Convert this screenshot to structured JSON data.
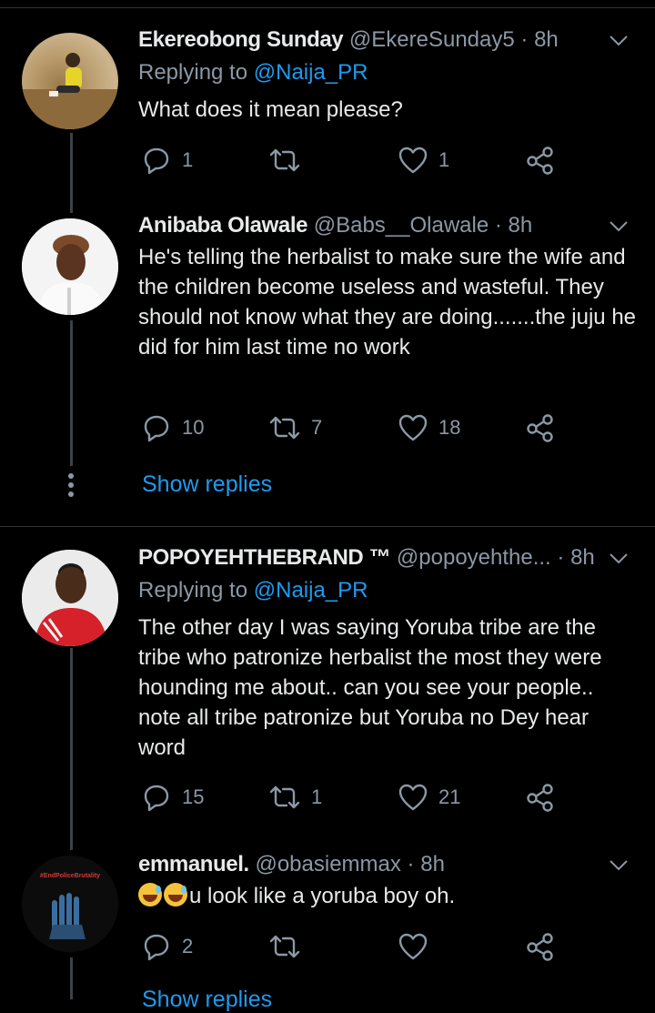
{
  "tweets": [
    {
      "name": "Ekereobong Sunday",
      "handle": "@EkereSunday5",
      "dot": "·",
      "time": "8h",
      "replying_label": "Replying to",
      "replying_to": "@Naija_PR",
      "text": "What does it mean please?",
      "replies": "1",
      "retweets": "",
      "likes": "1"
    },
    {
      "name": "Anibaba Olawale",
      "handle": "@Babs__Olawale",
      "dot": "·",
      "time": "8h",
      "text": "He's telling the herbalist to make sure the wife and the children become useless and wasteful. They should not know what they are doing.......the juju he did for him last time no work",
      "replies": "10",
      "retweets": "7",
      "likes": "18",
      "show_replies": "Show replies"
    },
    {
      "name": "POPOYEHTHEBRAND ™",
      "handle": "@popoyehthe...",
      "dot": "·",
      "time": "8h",
      "replying_label": "Replying to",
      "replying_to": "@Naija_PR",
      "text": "The other day I was saying Yoruba tribe are the tribe who patronize herbalist the most they were hounding me about.. can you see your people.. note all tribe patronize but Yoruba no Dey hear word",
      "replies": "15",
      "retweets": "1",
      "likes": "21"
    },
    {
      "name": "emmanuel.",
      "handle": "@obasiemmax",
      "dot": "·",
      "time": "8h",
      "emoji": "😅😅",
      "text": "u look like a yoruba boy oh.",
      "replies": "2",
      "retweets": "",
      "likes": "",
      "avatar_caption": "#EndPoliceBrutality",
      "show_replies_partial": "Show replies"
    }
  ],
  "colors": {
    "background": "#000000",
    "accent": "#1d9bf0",
    "muted": "#8b98a5",
    "text": "#e7e9ea"
  }
}
